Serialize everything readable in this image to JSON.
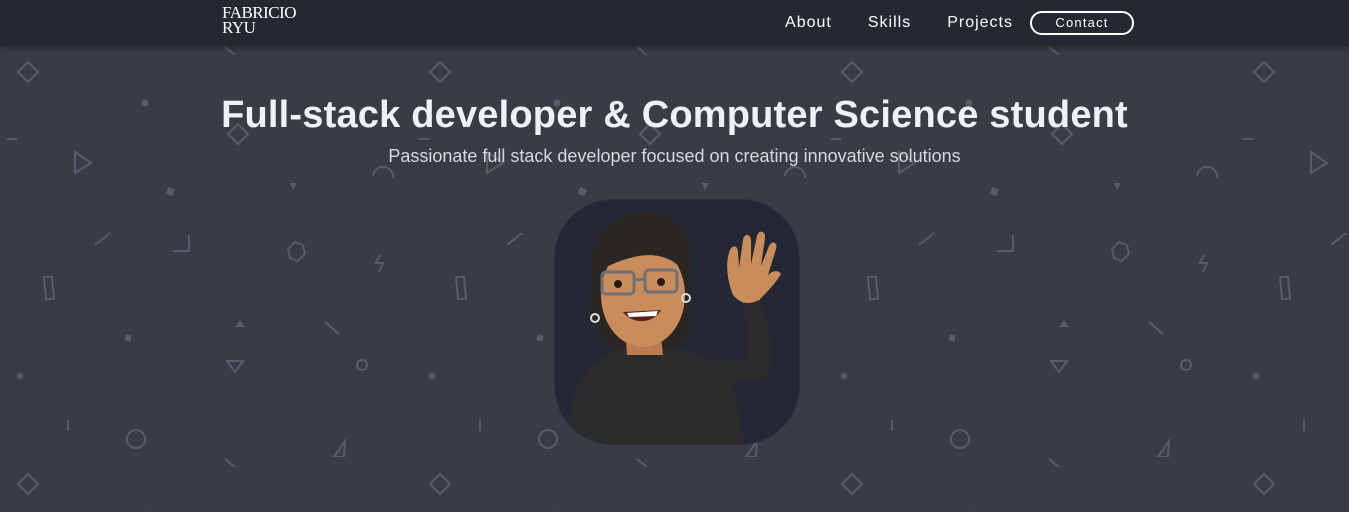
{
  "brand": {
    "logo_line1": "FABRICIO",
    "logo_line2": "RYU"
  },
  "nav": {
    "items": [
      "About",
      "Skills",
      "Projects"
    ],
    "contact_label": "Contact"
  },
  "hero": {
    "title": "Full-stack developer & Computer Science student",
    "subtitle": "Passionate full stack developer focused on creating innovative solutions"
  },
  "avatar": {
    "icon": "memoji-waving-avatar"
  },
  "colors": {
    "background": "#393c46",
    "navbar": "#242832",
    "text": "#eef1f8",
    "pattern": "#555a66"
  }
}
